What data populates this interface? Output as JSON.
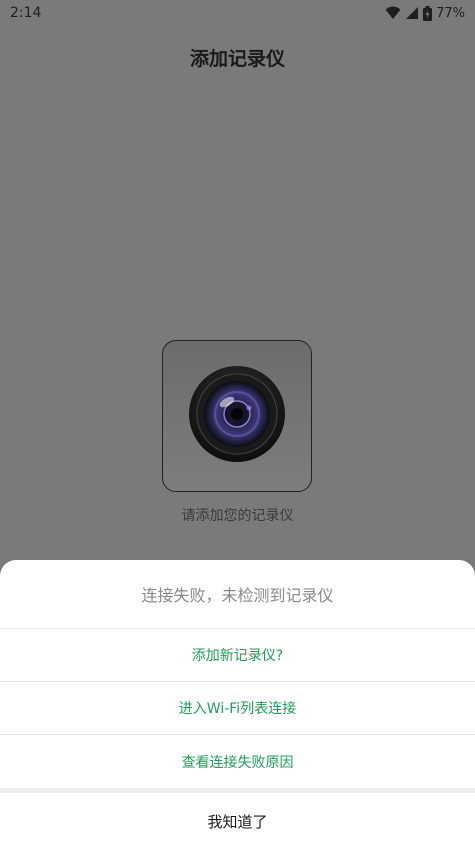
{
  "status_bar": {
    "time": "2:14",
    "battery": "77%",
    "icons": [
      "wifi-icon",
      "signal-icon",
      "battery-icon"
    ]
  },
  "header": {
    "title": "添加记录仪"
  },
  "main": {
    "device_icon": "dashcam-lens-icon",
    "hint": "请添加您的记录仪"
  },
  "sheet": {
    "title": "连接失败，未检测到记录仪",
    "options": [
      "添加新记录仪?",
      "进入Wi-Fi列表连接",
      "查看连接失败原因"
    ],
    "cancel": "我知道了"
  },
  "colors": {
    "overlay_bg": "#7a7a7a",
    "accent_green": "#1e9e5a",
    "sheet_title_gray": "#8a8a8a"
  }
}
